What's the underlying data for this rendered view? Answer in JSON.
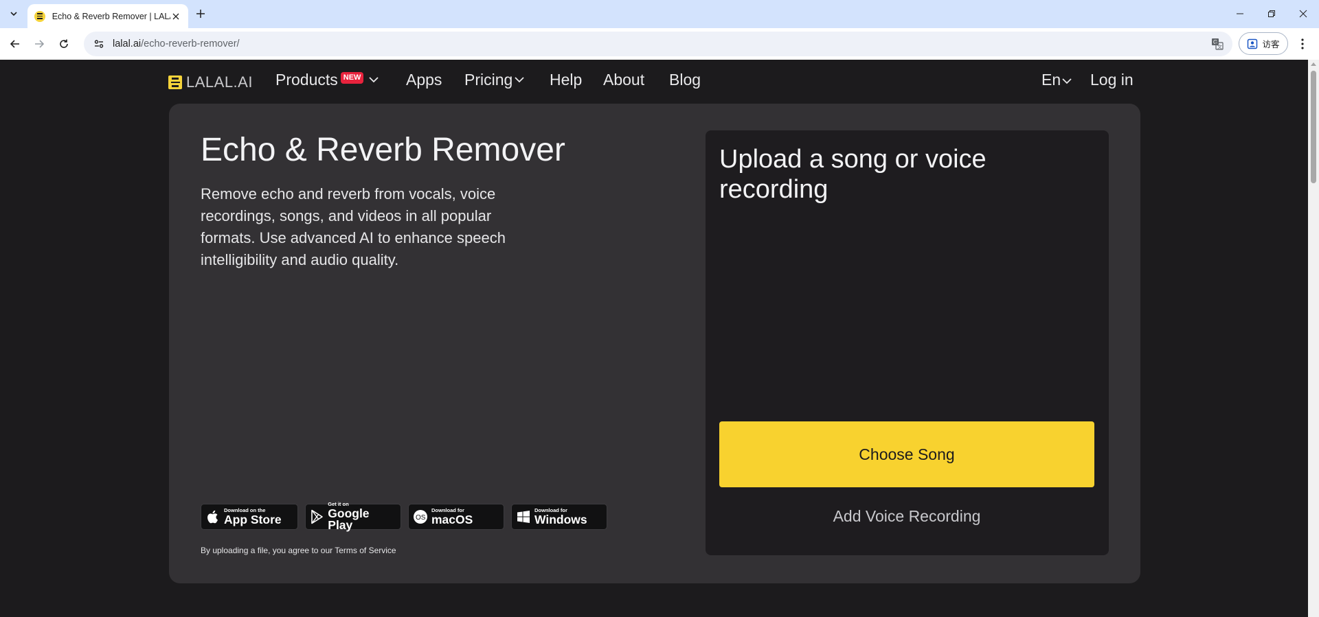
{
  "browser": {
    "tab_title": "Echo & Reverb Remover | LALAL.AI",
    "url_domain": "lalal.ai",
    "url_path": "/echo-reverb-remover/",
    "guest_label": "访客"
  },
  "nav": {
    "logo_text": "LALAL.AI",
    "products": "Products",
    "new_badge": "NEW",
    "apps": "Apps",
    "pricing": "Pricing",
    "help": "Help",
    "about": "About",
    "blog": "Blog",
    "language": "En",
    "login": "Log in"
  },
  "hero": {
    "title": "Echo & Reverb Remover",
    "description": "Remove echo and reverb from vocals, voice recordings, songs, and videos in all popular formats. Use advanced AI to enhance speech intelligibility and audio quality."
  },
  "stores": [
    {
      "small": "Download on the",
      "big": "App Store",
      "icon": "apple-icon"
    },
    {
      "small": "Get it on",
      "big": "Google Play",
      "icon": "google-play-icon"
    },
    {
      "small": "Download for",
      "big": "macOS",
      "icon": "macos-icon"
    },
    {
      "small": "Download for",
      "big": "Windows",
      "icon": "windows-icon"
    }
  ],
  "terms": {
    "prefix": "By uploading a file, you agree to our ",
    "link": "Terms of Service"
  },
  "upload": {
    "title": "Upload a song or voice recording",
    "choose_button": "Choose Song",
    "voice_button": "Add Voice Recording"
  },
  "colors": {
    "accent": "#f8d22f",
    "badge": "#e8233d",
    "page_bg": "#1c1b1d",
    "card_bg": "#333134"
  }
}
